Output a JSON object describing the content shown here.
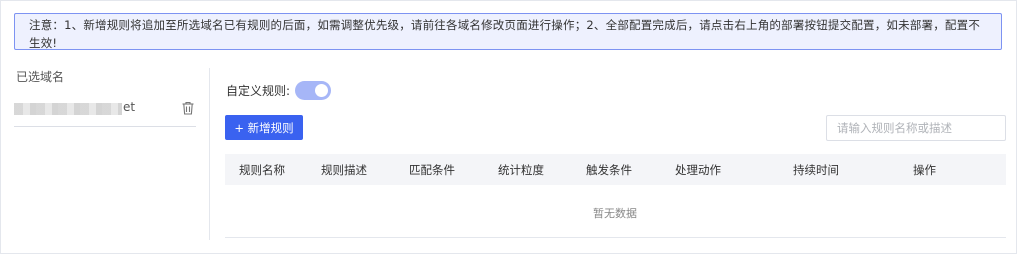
{
  "notice": {
    "text": "注意：1、新增规则将追加至所选域名已有规则的后面，如需调整优先级，请前往各域名修改页面进行操作；2、全部配置完成后，请点击右上角的部署按钮提交配置，如未部署，配置不生效!"
  },
  "sidebar": {
    "title": "已选域名",
    "domains": [
      {
        "suffix": "et"
      }
    ]
  },
  "custom_rule": {
    "label": "自定义规则:",
    "enabled": true
  },
  "toolbar": {
    "add_label": "+ 新增规则",
    "search_placeholder": "请输入规则名称或描述"
  },
  "table": {
    "columns": [
      "规则名称",
      "规则描述",
      "匹配条件",
      "统计粒度",
      "触发条件",
      "处理动作",
      "持续时间",
      "操作"
    ],
    "empty_text": "暂无数据"
  },
  "colors": {
    "primary": "#3a62f0",
    "notice_border": "#7d93f2",
    "notice_bg": "#eef1fe",
    "switch_on": "#a6b6f7"
  }
}
